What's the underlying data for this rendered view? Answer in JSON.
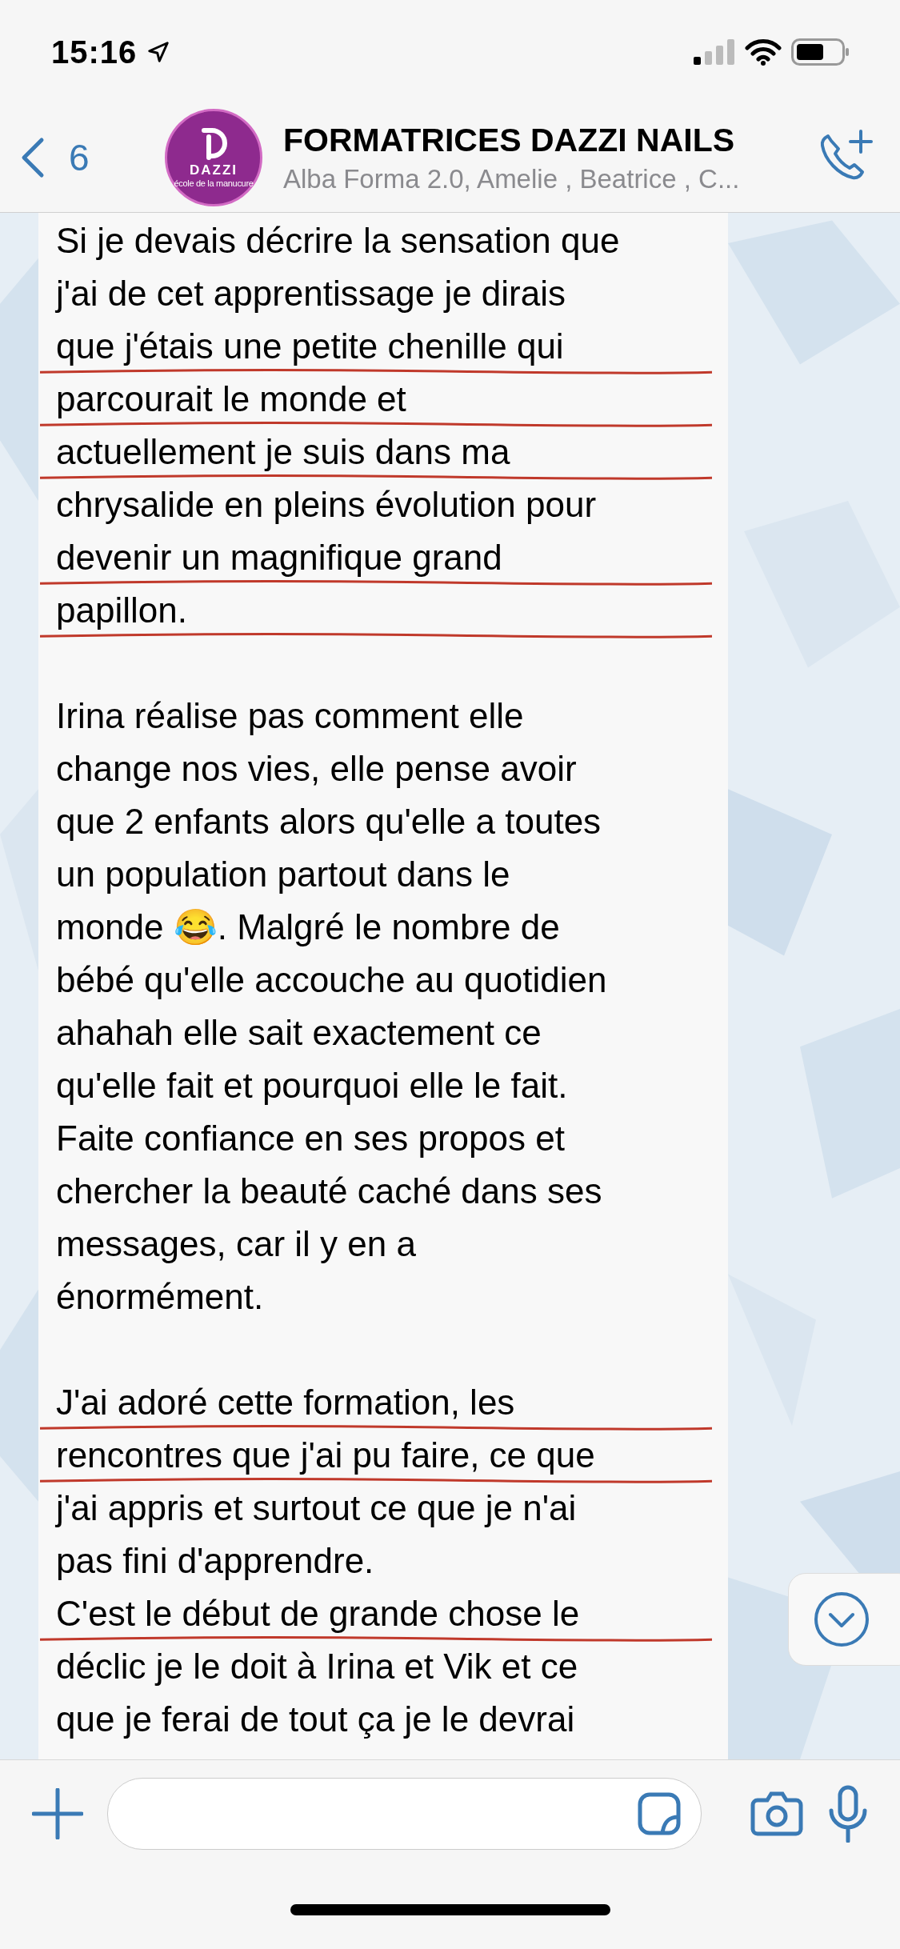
{
  "status_bar": {
    "time": "15:16"
  },
  "header": {
    "back_count": "6",
    "avatar_text": "DAZZI",
    "avatar_subtext": "école de la manucure",
    "title": "FORMATRICES DAZZI NAILS",
    "subtitle": "Alba Forma 2.0, Amelie , Beatrice , C..."
  },
  "message": {
    "paragraphs": [
      {
        "lines": [
          {
            "text": "Si je devais décrire la sensation que",
            "underlined": false
          },
          {
            "text": "j'ai de cet apprentissage je dirais",
            "underlined": false
          },
          {
            "text": "que j'étais une petite chenille qui",
            "underlined": true
          },
          {
            "text": "parcourait le monde et",
            "underlined": true
          },
          {
            "text": "actuellement je suis dans ma",
            "underlined": true
          },
          {
            "text": "chrysalide en pleins évolution pour",
            "underlined": false
          },
          {
            "text": "devenir un magnifique grand",
            "underlined": true
          },
          {
            "text": "papillon.",
            "underlined": true
          }
        ]
      },
      {
        "lines": [
          {
            "text": "Irina réalise pas comment elle",
            "underlined": false
          },
          {
            "text": "change nos vies, elle pense avoir",
            "underlined": false
          },
          {
            "text": "que 2 enfants alors qu'elle a toutes",
            "underlined": false
          },
          {
            "text": "un population partout dans le",
            "underlined": false
          },
          {
            "text": "monde 😂. Malgré le nombre de",
            "underlined": false
          },
          {
            "text": "bébé qu'elle accouche au quotidien",
            "underlined": false
          },
          {
            "text": "ahahah elle sait exactement ce",
            "underlined": false
          },
          {
            "text": "qu'elle fait et pourquoi elle le fait.",
            "underlined": false
          },
          {
            "text": "Faite confiance en ses propos et",
            "underlined": false
          },
          {
            "text": "chercher la beauté caché dans ses",
            "underlined": false
          },
          {
            "text": "messages, car il y en a",
            "underlined": false
          },
          {
            "text": "énormément.",
            "underlined": false
          }
        ]
      },
      {
        "lines": [
          {
            "text": "J'ai adoré cette formation, les",
            "underlined": true
          },
          {
            "text": "rencontres que j'ai pu faire, ce que",
            "underlined": true
          },
          {
            "text": "j'ai appris et surtout ce que je n'ai",
            "underlined": false
          },
          {
            "text": "pas fini d'apprendre.",
            "underlined": false
          },
          {
            "text": "C'est le début de grande chose le",
            "underlined": true
          },
          {
            "text": "déclic je le doit à Irina et Vik et ce",
            "underlined": false
          },
          {
            "text": "que je ferai de tout ça je le devrai",
            "underlined": false
          }
        ]
      }
    ]
  }
}
